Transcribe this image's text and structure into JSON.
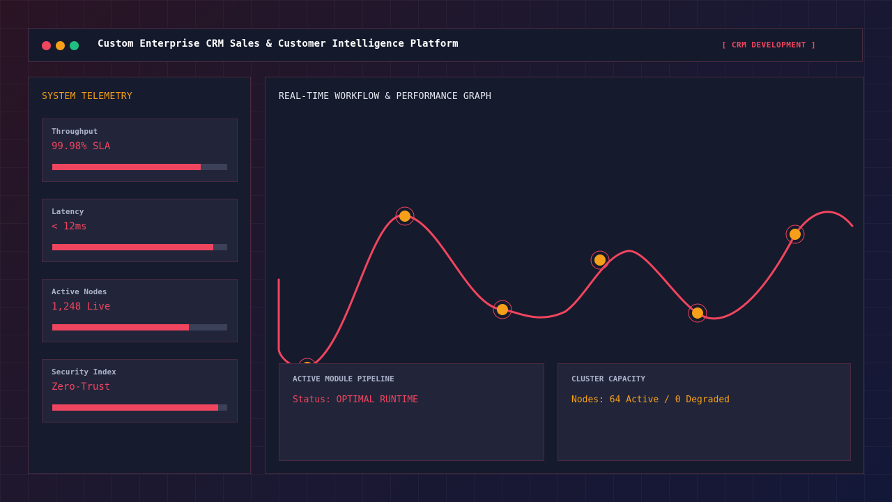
{
  "window": {
    "title": "Custom Enterprise CRM Sales & Customer Intelligence Platform",
    "tag": "[ CRM DEVELOPMENT ]",
    "dots": [
      "#f0455f",
      "#f5a018",
      "#1fbf7f"
    ]
  },
  "sidebar": {
    "title": "SYSTEM TELEMETRY",
    "metrics": [
      {
        "label": "Throughput",
        "value": "99.98% SLA",
        "progress": 0.85
      },
      {
        "label": "Latency",
        "value": "< 12ms",
        "progress": 0.92
      },
      {
        "label": "Active Nodes",
        "value": "1,248 Live",
        "progress": 0.78
      },
      {
        "label": "Security Index",
        "value": "Zero-Trust",
        "progress": 0.95
      }
    ]
  },
  "main": {
    "title": "REAL-TIME WORKFLOW & PERFORMANCE GRAPH",
    "graph": {
      "line_color": "#f0455f",
      "node_color": "#f5a018",
      "node_count": 6
    },
    "cards": [
      {
        "title": "ACTIVE MODULE PIPELINE",
        "status": "Status: OPTIMAL RUNTIME",
        "status_color": "#f0455f"
      },
      {
        "title": "CLUSTER CAPACITY",
        "status": "Nodes: 64 Active / 0 Degraded",
        "status_color": "#f5a018"
      }
    ]
  },
  "colors": {
    "accent": "#f0455f",
    "warning": "#f5a018",
    "success": "#1fbf7f"
  }
}
